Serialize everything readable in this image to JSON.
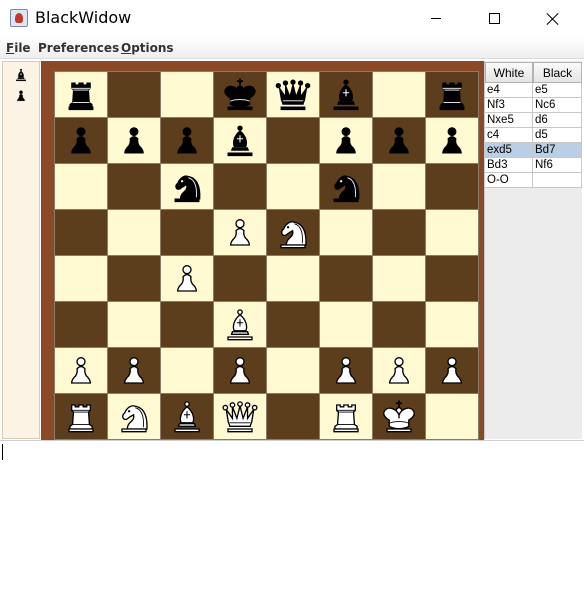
{
  "window": {
    "title": "BlackWidow",
    "icon": "java-cup-icon"
  },
  "menu": {
    "items": [
      {
        "label": "File",
        "mnemonic": "F"
      },
      {
        "label": "Preferences",
        "mnemonic": ""
      },
      {
        "label": "Options",
        "mnemonic": "O"
      }
    ]
  },
  "captured_pieces": [
    "black-bishop",
    "black-pawn"
  ],
  "board": {
    "colors": {
      "light": "#fffad2",
      "dark": "#5c3e1c",
      "frame": "#8b4a26"
    },
    "ranks": [
      [
        "bR",
        "",
        "",
        "bK",
        "bQ",
        "bB",
        "",
        "bR"
      ],
      [
        "bP",
        "bP",
        "bP",
        "bB",
        "",
        "bP",
        "bP",
        "bP"
      ],
      [
        "",
        "",
        "bN",
        "",
        "",
        "bN",
        "",
        ""
      ],
      [
        "",
        "",
        "",
        "wP",
        "wN",
        "",
        "",
        ""
      ],
      [
        "",
        "",
        "wP",
        "",
        "",
        "",
        "",
        ""
      ],
      [
        "",
        "",
        "",
        "wB",
        "",
        "",
        "",
        ""
      ],
      [
        "wP",
        "wP",
        "",
        "wP",
        "",
        "wP",
        "wP",
        "wP"
      ],
      [
        "wR",
        "wN",
        "wB",
        "wQ",
        "",
        "wR",
        "wK",
        ""
      ]
    ]
  },
  "moves": {
    "headers": {
      "white": "White",
      "black": "Black"
    },
    "rows": [
      {
        "white": "e4",
        "black": "e5"
      },
      {
        "white": "Nf3",
        "black": "Nc6"
      },
      {
        "white": "Nxe5",
        "black": "d6"
      },
      {
        "white": "c4",
        "black": "d5"
      },
      {
        "white": "exd5",
        "black": "Bd7"
      },
      {
        "white": "Bd3",
        "black": "Nf6"
      },
      {
        "white": "O-O",
        "black": ""
      }
    ],
    "selected_row": 4,
    "selection_color": "#b8cfe5"
  }
}
